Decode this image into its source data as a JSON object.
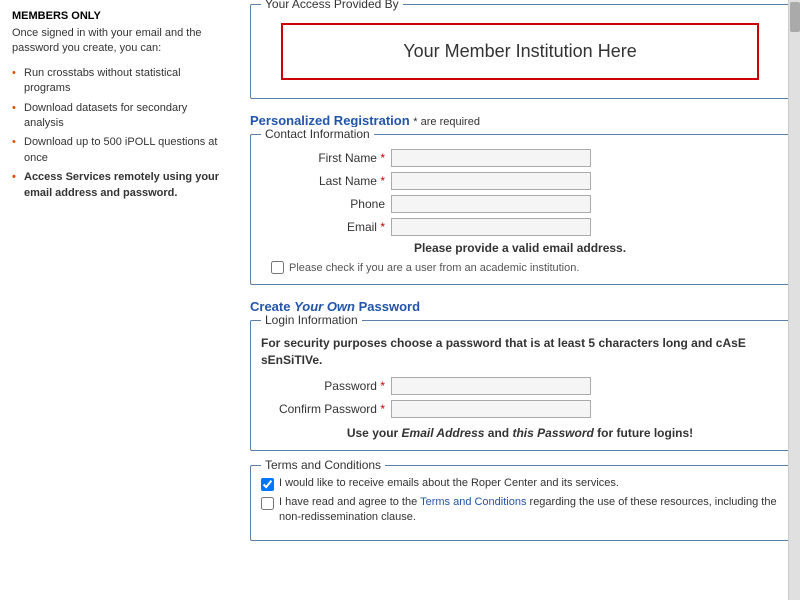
{
  "sidebar": {
    "title": "MEMBERS ONLY",
    "intro": "Once signed in with your email and the password you create, you can:",
    "items": [
      {
        "text": "Run crosstabs without statistical programs",
        "bold": false
      },
      {
        "text": "Download datasets for secondary analysis",
        "bold": false
      },
      {
        "text": "Download up to 500 iPOLL questions at once",
        "bold": false
      },
      {
        "text": "Access Services remotely using your email address and password.",
        "bold": true
      }
    ]
  },
  "access_section": {
    "legend": "Your Access Provided By",
    "institution_name": "Your Member Institution Here"
  },
  "personalized_registration": {
    "heading": "Personalized Registration",
    "required_text": "* are required"
  },
  "contact_info": {
    "legend": "Contact Information",
    "fields": [
      {
        "label": "First Name",
        "required": true,
        "placeholder": ""
      },
      {
        "label": "Last Name",
        "required": true,
        "placeholder": ""
      },
      {
        "label": "Phone",
        "required": false,
        "placeholder": ""
      },
      {
        "label": "Email",
        "required": true,
        "placeholder": ""
      }
    ],
    "email_notice": "Please provide a valid email address.",
    "academic_checkbox_label": "Please check if you are a user from an academic institution."
  },
  "create_password": {
    "heading_part1": "Create ",
    "heading_italic1": "Your Own",
    "heading_part2": " Password",
    "security_note": "For security purposes choose a password that is at least 5 characters long and cAsE sEnSiTIVe.",
    "fields": [
      {
        "label": "Password",
        "required": true
      },
      {
        "label": "Confirm Password",
        "required": true
      }
    ],
    "use_note_part1": "Use your ",
    "use_note_email": "Email Address",
    "use_note_part2": " and ",
    "use_note_password": "this Password",
    "use_note_part3": " for future logins!"
  },
  "login_information": {
    "legend": "Login Information"
  },
  "terms_conditions": {
    "legend": "Terms and Conditions",
    "checkbox1_label": "I would like to receive emails about the Roper Center and its services.",
    "checkbox2_label_part1": "I have read and agree to the ",
    "checkbox2_link_text": "Terms and Conditions",
    "checkbox2_label_part2": " regarding the use of these resources, including the non-redissemination clause.",
    "checkbox1_checked": true,
    "checkbox2_checked": false
  }
}
